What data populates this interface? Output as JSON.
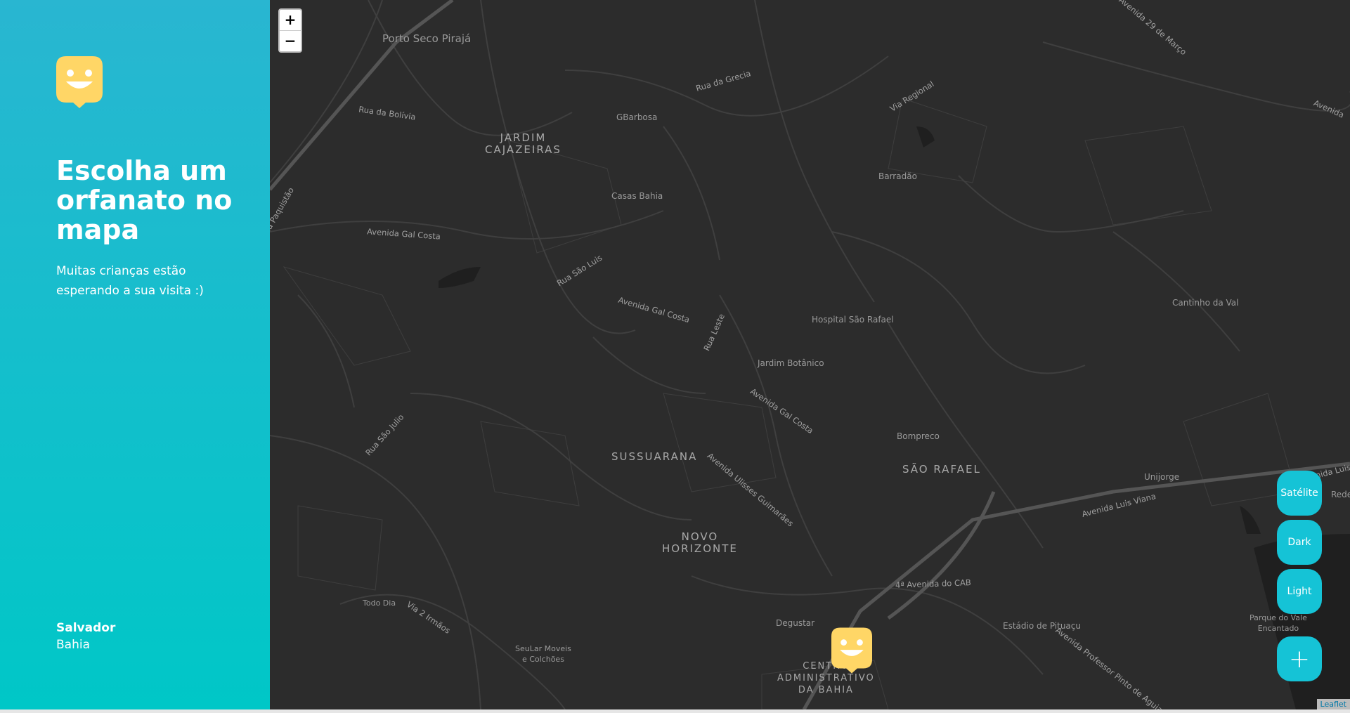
{
  "sidebar": {
    "title": "Escolha um orfanato no mapa",
    "subtitle": "Muitas crianças estão esperando a sua visita :)",
    "city": "Salvador",
    "state": "Bahia",
    "logo_icon": "happy-face-icon",
    "brand_color": "#FFD666"
  },
  "map": {
    "zoom_in": "+",
    "zoom_out": "−",
    "labels": {
      "porto_seco": "Porto Seco Pirajá",
      "rua_bolivia": "Rua da Bolívia",
      "jardim_cajazeiras": "JARDIM\nCAJAZEIRAS",
      "gbarbosa": "GBarbosa",
      "rua_grecia": "Rua da Grecia",
      "via_regional": "Via Regional",
      "av29": "Avenida 29 de Março",
      "avenida_right": "Avenida",
      "barradao": "Barradão",
      "casas_bahia": "Casas Bahia",
      "paquistao": "Rua Paquistão",
      "av_gal_costa_1": "Avenida Gal Costa",
      "rua_sao_luis": "Rua São Luis",
      "av_gal_costa_2": "Avenida Gal Costa",
      "rua_leste": "Rua Leste",
      "hospital": "Hospital São Rafael",
      "cantinho": "Cantinho da Val",
      "jardim_botanico": "Jardim Botânico",
      "av_gal_costa_3": "Avenida Gal Costa",
      "bompreco": "Bompreco",
      "rua_sao_julio": "Rua São Julio",
      "sussuarana": "SUSSUARANA",
      "av_ulisses": "Avenida Ulisses Guimarães",
      "sao_rafael": "SÃO RAFAEL",
      "unijorge": "Unijorge",
      "av_luis_viana": "Avenida Luis Viana",
      "av_luis_viana_2": "Avenida Luis Viana",
      "rede": "Rede",
      "novo_horizonte": "NOVO\nHORIZONTE",
      "av_cab": "4ª Avenida do CAB",
      "todo_dia": "Todo Dia",
      "via_2_irmaos": "Via 2 Irmãos",
      "degustar": "Degustar",
      "estadio": "Estádio de Pituaçu",
      "av_pinto_aguiar": "Avenida Professor Pinto de Aguiar",
      "parque_vale": "Parque do Vale\nEncantado",
      "seular": "SeuLar Moveis\ne Colchões",
      "centro_adm": "CENTRO\nADMINISTRATIVO\nDA BAHIA"
    },
    "buttons": {
      "satellite": "Satélite",
      "dark": "Dark",
      "light": "Light",
      "add": "+"
    },
    "attribution": "Leaflet",
    "marker_icon": "orphanage-marker-icon",
    "accent_color": "#15C3D6"
  }
}
